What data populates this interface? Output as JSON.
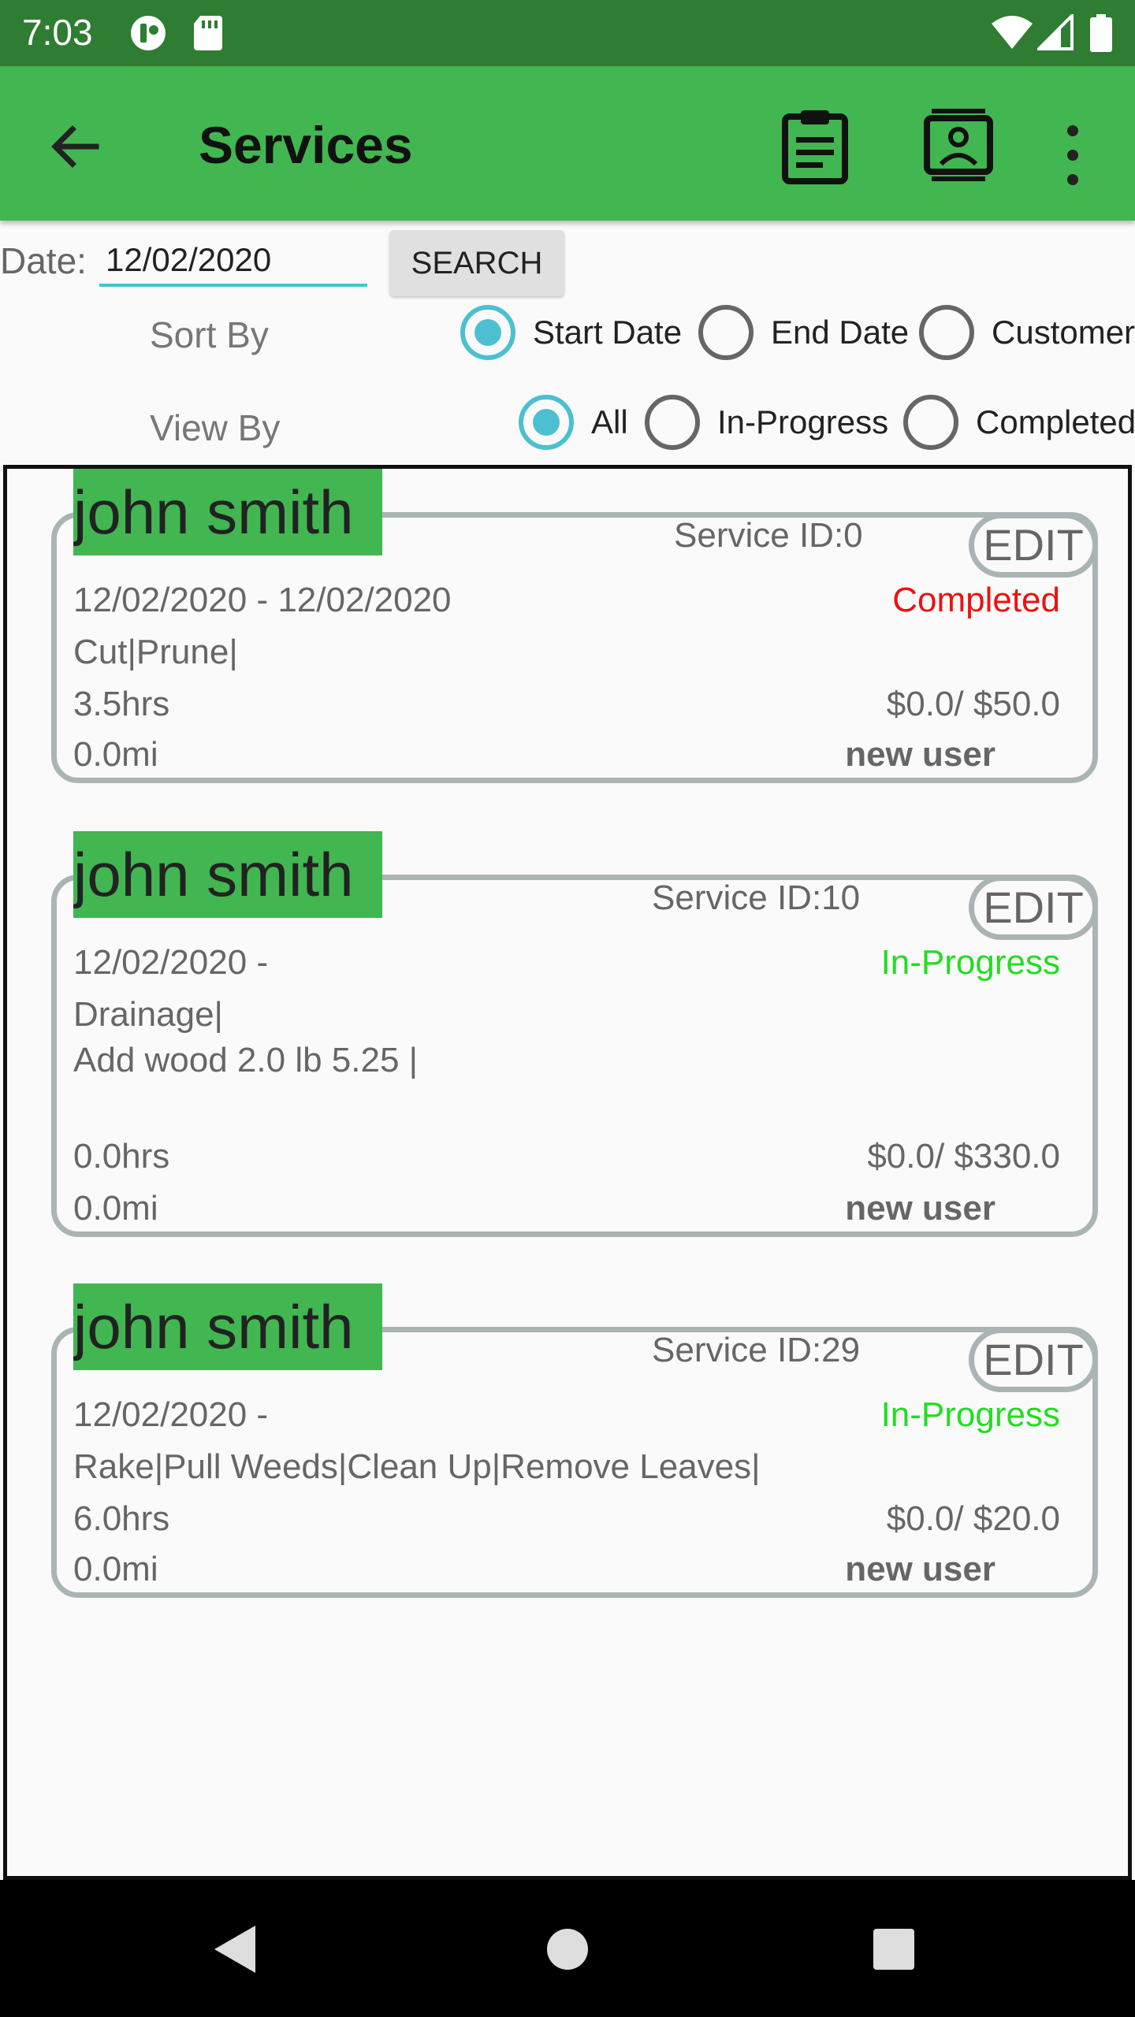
{
  "status_bar": {
    "time": "7:03"
  },
  "app_bar": {
    "title": "Services",
    "icons": [
      "back-arrow-icon",
      "clipboard-icon",
      "contact-card-icon",
      "overflow-menu-icon"
    ]
  },
  "search": {
    "date_label": "Date:",
    "date_value": "12/02/2020",
    "button_label": "SEARCH"
  },
  "sort_by": {
    "label": "Sort By",
    "options": [
      "Start Date",
      "End Date",
      "Customer"
    ],
    "selected": "Start Date"
  },
  "view_by": {
    "label": "View By",
    "options": [
      "All",
      "In-Progress",
      "Completed"
    ],
    "selected": "All"
  },
  "colors": {
    "status_bar": "#2e7d32",
    "app_bar": "#41b651",
    "accent": "#4cc0d0",
    "completed": "#ee1111",
    "in_progress": "#22dd22",
    "card_border": "#aab4b4"
  },
  "services": [
    {
      "customer": "john smith",
      "service_id": "Service ID:0",
      "edit_label": "EDIT",
      "dates": "12/02/2020 - 12/02/2020",
      "status": "Completed",
      "tasks": "Cut|Prune|",
      "materials": "",
      "hours": "3.5hrs",
      "price": "$0.0/  $50.0",
      "distance": "0.0mi",
      "user": "new user"
    },
    {
      "customer": "john smith",
      "service_id": "Service ID:10",
      "edit_label": "EDIT",
      "dates": "12/02/2020 -",
      "status": "In-Progress",
      "tasks": "Drainage|",
      "materials": "Add wood 2.0 lb 5.25 |",
      "hours": "0.0hrs",
      "price": "$0.0/  $330.0",
      "distance": "0.0mi",
      "user": "new user"
    },
    {
      "customer": "john smith",
      "service_id": "Service ID:29",
      "edit_label": "EDIT",
      "dates": "12/02/2020 -",
      "status": "In-Progress",
      "tasks": "Rake|Pull Weeds|Clean Up|Remove Leaves|",
      "materials": "",
      "hours": "6.0hrs",
      "price": "$0.0/  $20.0",
      "distance": "0.0mi",
      "user": "new user"
    }
  ]
}
